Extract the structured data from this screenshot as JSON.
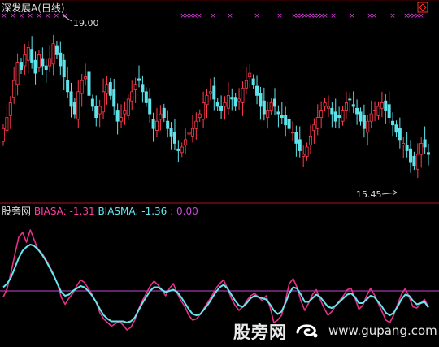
{
  "header": {
    "stock_title": "深发展A",
    "period": "(日线)"
  },
  "indicator": {
    "name": "股旁网",
    "biasa_label": "BIASA:",
    "biasa_value": "-1.31",
    "biasma_label": "BIASMA:",
    "biasma_value": "-1.36",
    "zero_label": ":",
    "zero_value": "0.00"
  },
  "annotations": {
    "high_price": "19.00",
    "low_price": "15.45"
  },
  "watermark": {
    "site_name": "股旁网",
    "url": "www.gupang.com",
    "logo_icon": "swirl-logo-icon"
  },
  "colors": {
    "background": "#000000",
    "up_candle": "#ff3b4e",
    "down_candle": "#5fe3ea",
    "signal_marker": "#e040e0",
    "biasa_line": "#e8308a",
    "biasma_line": "#66e6ee",
    "zero_line": "#c94ad0",
    "divider": "#b01020"
  },
  "chart_data": [
    {
      "type": "candlestick",
      "title": "深发展A (日线)",
      "ylim": [
        14.8,
        19.6
      ],
      "annotations": [
        {
          "label": "19.00",
          "type": "high"
        },
        {
          "label": "15.45",
          "type": "low"
        }
      ],
      "closes": [
        16.6,
        16.9,
        17.3,
        17.9,
        18.4,
        18.2,
        18.6,
        18.8,
        18.4,
        18.1,
        18.6,
        18.3,
        18.2,
        18.5,
        18.9,
        18.6,
        18.3,
        18.0,
        17.6,
        17.2,
        17.0,
        17.6,
        17.9,
        18.0,
        17.5,
        17.2,
        16.9,
        17.2,
        17.6,
        17.8,
        17.5,
        17.2,
        16.8,
        16.9,
        17.1,
        17.4,
        17.6,
        17.8,
        17.9,
        17.6,
        17.3,
        17.0,
        16.6,
        16.8,
        17.0,
        16.9,
        16.6,
        16.4,
        16.2,
        16.0,
        16.1,
        16.3,
        16.5,
        16.6,
        16.8,
        17.0,
        17.3,
        17.5,
        17.6,
        17.4,
        17.2,
        17.1,
        17.3,
        17.5,
        17.4,
        17.2,
        17.4,
        17.7,
        17.9,
        18.1,
        17.8,
        17.5,
        17.2,
        17.0,
        17.1,
        17.3,
        17.2,
        17.0,
        16.9,
        16.7,
        16.6,
        16.5,
        16.2,
        16.0,
        15.9,
        16.1,
        16.4,
        16.7,
        16.9,
        17.1,
        17.3,
        17.2,
        17.0,
        16.8,
        16.9,
        17.1,
        17.3,
        17.4,
        17.2,
        17.0,
        16.8,
        16.6,
        16.8,
        17.0,
        17.1,
        17.2,
        17.3,
        17.1,
        16.9,
        16.7,
        16.5,
        16.3,
        16.2,
        16.0,
        15.7,
        15.6,
        15.9,
        16.2,
        16.1,
        15.9
      ],
      "markers": "pink x signals along top row"
    },
    {
      "type": "line",
      "series": [
        {
          "name": "BIASA",
          "values": [
            -0.5,
            0.2,
            1.5,
            3.0,
            4.4,
            4.8,
            4.0,
            5.0,
            4.2,
            3.4,
            3.1,
            2.6,
            2.0,
            1.4,
            0.6,
            -0.5,
            -1.1,
            -0.6,
            -0.2,
            0.4,
            0.9,
            0.7,
            0.2,
            -0.3,
            -0.9,
            -1.8,
            -2.3,
            -2.6,
            -2.9,
            -2.7,
            -2.5,
            -2.8,
            -3.2,
            -3.0,
            -2.4,
            -1.5,
            -0.8,
            -0.2,
            0.4,
            0.8,
            0.5,
            0.1,
            -0.4,
            0.2,
            0.6,
            -0.2,
            -0.8,
            -1.3,
            -2.0,
            -2.4,
            -2.3,
            -1.9,
            -1.4,
            -0.9,
            -0.4,
            0.2,
            0.6,
            0.9,
            0.2,
            -0.6,
            -1.2,
            -1.6,
            -1.3,
            -0.8,
            -0.4,
            -0.2,
            -0.5,
            -0.8,
            -0.4,
            -1.3,
            -2.6,
            -2.4,
            -2.0,
            -0.8,
            0.6,
            1.0,
            0.3,
            -0.8,
            -1.6,
            -1.0,
            -0.3,
            0.1,
            -0.7,
            -1.4,
            -2.0,
            -1.7,
            -1.2,
            -0.8,
            -0.4,
            0.1,
            0.2,
            -0.6,
            -1.5,
            -1.2,
            -0.4,
            0.2,
            -0.3,
            -1.0,
            -1.7,
            -2.4,
            -2.6,
            -2.0,
            -1.1,
            -0.3,
            0.2,
            -0.5,
            -1.3,
            -1.4,
            -1.0,
            -0.7,
            -1.31
          ],
          "values_unit": "%"
        },
        {
          "name": "BIASMA",
          "values": [
            0.3,
            0.6,
            1.1,
            1.9,
            2.7,
            3.3,
            3.6,
            3.8,
            3.7,
            3.4,
            3.0,
            2.5,
            1.9,
            1.3,
            0.6,
            -0.1,
            -0.4,
            -0.3,
            0.0,
            0.2,
            0.4,
            0.3,
            0.0,
            -0.4,
            -0.9,
            -1.5,
            -2.0,
            -2.3,
            -2.5,
            -2.5,
            -2.5,
            -2.5,
            -2.6,
            -2.5,
            -2.2,
            -1.6,
            -1.0,
            -0.5,
            0.0,
            0.3,
            0.3,
            0.1,
            -0.1,
            0.0,
            0.1,
            -0.1,
            -0.5,
            -1.0,
            -1.5,
            -1.9,
            -2.0,
            -1.9,
            -1.5,
            -1.1,
            -0.6,
            -0.1,
            0.3,
            0.5,
            0.2,
            -0.3,
            -0.8,
            -1.2,
            -1.3,
            -1.0,
            -0.6,
            -0.4,
            -0.5,
            -0.6,
            -0.7,
            -1.1,
            -1.6,
            -1.9,
            -1.7,
            -1.0,
            -0.2,
            0.3,
            0.2,
            -0.3,
            -0.9,
            -0.9,
            -0.6,
            -0.3,
            -0.5,
            -0.9,
            -1.3,
            -1.4,
            -1.2,
            -0.9,
            -0.6,
            -0.3,
            -0.2,
            -0.5,
            -1.0,
            -1.0,
            -0.7,
            -0.4,
            -0.5,
            -0.9,
            -1.3,
            -1.8,
            -2.0,
            -1.8,
            -1.3,
            -0.7,
            -0.3,
            -0.4,
            -0.8,
            -1.1,
            -1.0,
            -0.9,
            -1.36
          ],
          "values_unit": "%"
        }
      ],
      "reference_line": 0.0
    }
  ]
}
